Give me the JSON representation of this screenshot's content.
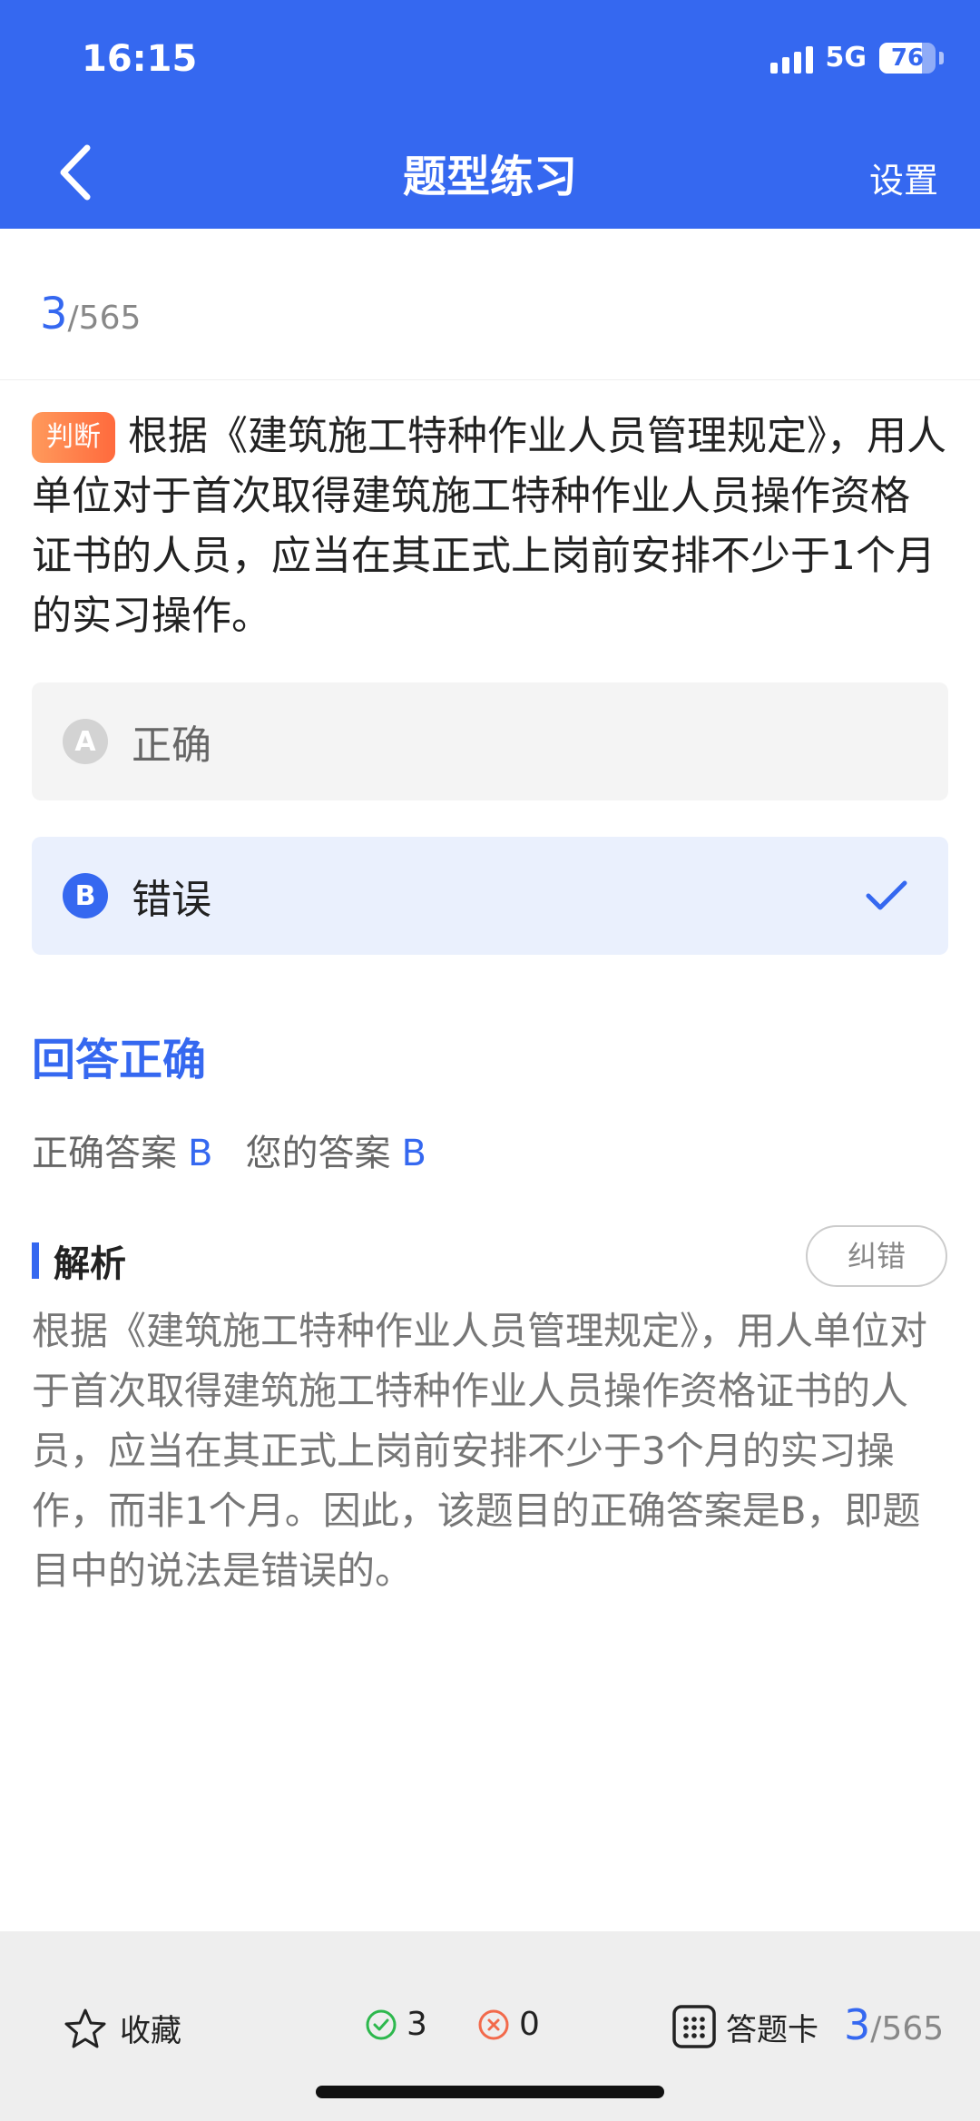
{
  "status": {
    "time": "16:15",
    "network": "5G",
    "battery": "76"
  },
  "nav": {
    "title": "题型练习",
    "settings_label": "设置"
  },
  "progress": {
    "current": "3",
    "total": "/565"
  },
  "question": {
    "type_tag": "判断",
    "text": "根据《建筑施工特种作业人员管理规定》，用人单位对于首次取得建筑施工特种作业人员操作资格证书的人员，应当在其正式上岗前安排不少于1个月的实习操作。"
  },
  "options": [
    {
      "letter": "A",
      "text": "正确"
    },
    {
      "letter": "B",
      "text": "错误"
    }
  ],
  "result": {
    "title": "回答正确",
    "correct_label": "正确答案",
    "correct_value": "B",
    "yours_label": "您的答案",
    "yours_value": "B"
  },
  "analysis": {
    "title": "解析",
    "correction_label": "纠错",
    "text": "根据《建筑施工特种作业人员管理规定》，用人单位对于首次取得建筑施工特种作业人员操作资格证书的人员，应当在其正式上岗前安排不少于3个月的实习操作，而非1个月。因此，该题目的正确答案是B，即题目中的说法是错误的。"
  },
  "footer": {
    "favorite_label": "收藏",
    "correct_count": "3",
    "wrong_count": "0",
    "card_label": "答题卡",
    "progress_current": "3",
    "progress_total": "/565"
  },
  "colors": {
    "primary": "#3568F0",
    "tag": "#FF6A3D",
    "correct": "#2DB84D",
    "wrong": "#F26A4B"
  },
  "icons": [
    "back-chevron-icon",
    "check-icon",
    "star-icon",
    "check-circle-icon",
    "x-circle-icon",
    "grid-icon"
  ]
}
